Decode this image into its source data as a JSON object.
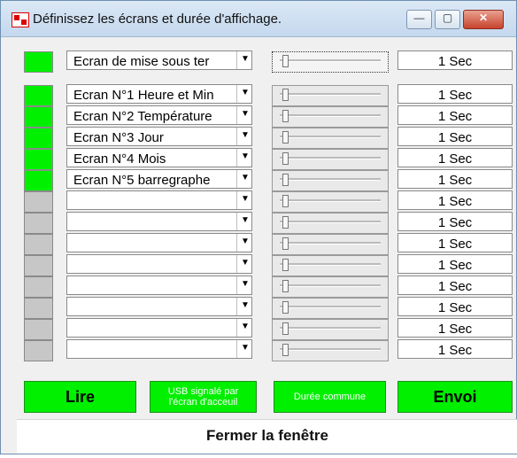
{
  "window": {
    "title": "Définissez les écrans et durée d'affichage."
  },
  "rows": [
    {
      "status": "on",
      "screen": "Ecran de mise sous ter",
      "duration": "1 Sec"
    },
    {
      "status": "on",
      "screen": "Ecran N°1 Heure et Min",
      "duration": "1 Sec"
    },
    {
      "status": "on",
      "screen": "Ecran N°2 Température",
      "duration": "1 Sec"
    },
    {
      "status": "on",
      "screen": "Ecran N°3 Jour",
      "duration": "1 Sec"
    },
    {
      "status": "on",
      "screen": "Ecran N°4 Mois",
      "duration": "1 Sec"
    },
    {
      "status": "on",
      "screen": "Ecran N°5 barregraphe",
      "duration": "1 Sec"
    },
    {
      "status": "off",
      "screen": "",
      "duration": "1 Sec"
    },
    {
      "status": "off",
      "screen": "",
      "duration": "1 Sec"
    },
    {
      "status": "off",
      "screen": "",
      "duration": "1 Sec"
    },
    {
      "status": "off",
      "screen": "",
      "duration": "1 Sec"
    },
    {
      "status": "off",
      "screen": "",
      "duration": "1 Sec"
    },
    {
      "status": "off",
      "screen": "",
      "duration": "1 Sec"
    },
    {
      "status": "off",
      "screen": "",
      "duration": "1 Sec"
    },
    {
      "status": "off",
      "screen": "",
      "duration": "1 Sec"
    }
  ],
  "buttons": {
    "lire": "Lire",
    "usb_line1": "USB signalé par",
    "usb_line2": "l'écran d'acceuil",
    "duree": "Durée commune",
    "envoi": "Envoi",
    "close": "Fermer la fenêtre"
  },
  "icons": {
    "dropdown": "chevron-down-icon",
    "window_min": "minimize-icon",
    "window_max": "maximize-icon",
    "window_close": "close-icon"
  }
}
